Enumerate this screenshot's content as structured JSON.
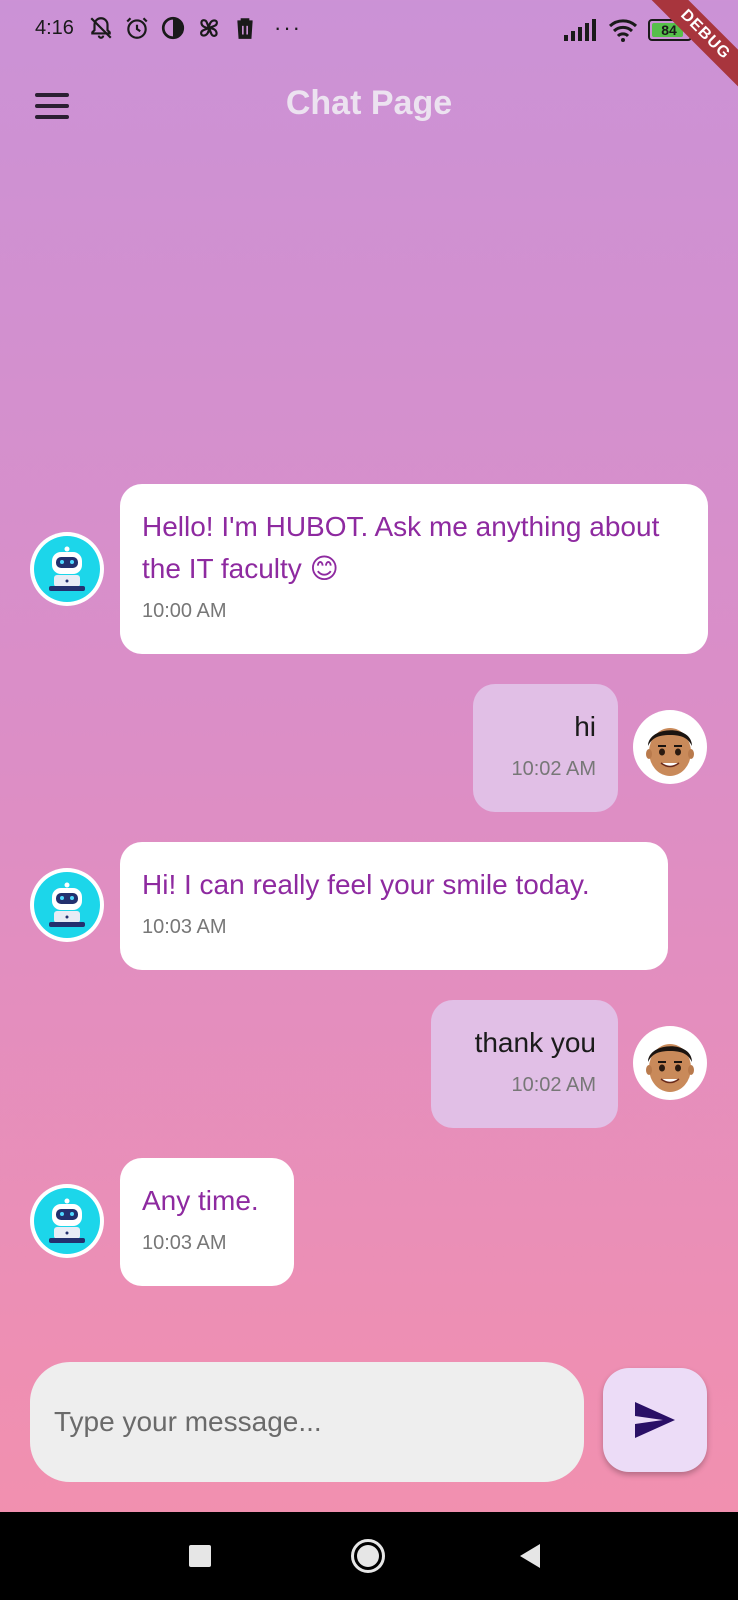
{
  "status_bar": {
    "time": "4:16",
    "more": "···",
    "battery": "84",
    "debug_banner": "DEBUG",
    "icons": [
      "notifications-off-icon",
      "alarm-icon",
      "data-saver-icon",
      "pinwheel-icon",
      "trash-icon",
      "signal-icon",
      "wifi-icon",
      "battery-icon"
    ]
  },
  "app_bar": {
    "title": "Chat Page",
    "menu_icon": "menu-icon"
  },
  "messages": [
    {
      "sender": "bot",
      "text": "Hello! I'm HUBOT. Ask me anything about the IT faculty 😊",
      "time": "10:00 AM"
    },
    {
      "sender": "user",
      "text": "hi",
      "time": "10:02 AM"
    },
    {
      "sender": "bot",
      "text": "Hi!  I can really feel your smile today.",
      "time": "10:03 AM"
    },
    {
      "sender": "user",
      "text": "thank you",
      "time": "10:02 AM"
    },
    {
      "sender": "bot",
      "text": "Any time.",
      "time": "10:03 AM"
    }
  ],
  "composer": {
    "placeholder": "Type your message...",
    "value": "",
    "send_icon": "send-icon"
  },
  "colors": {
    "bot_text": "#8e2aa0",
    "user_bubble": "#e1bfe6",
    "send_button": "#ecdcf7"
  },
  "nav_bar": {
    "icons": [
      "recents-square-icon",
      "home-circle-icon",
      "back-triangle-icon"
    ]
  }
}
